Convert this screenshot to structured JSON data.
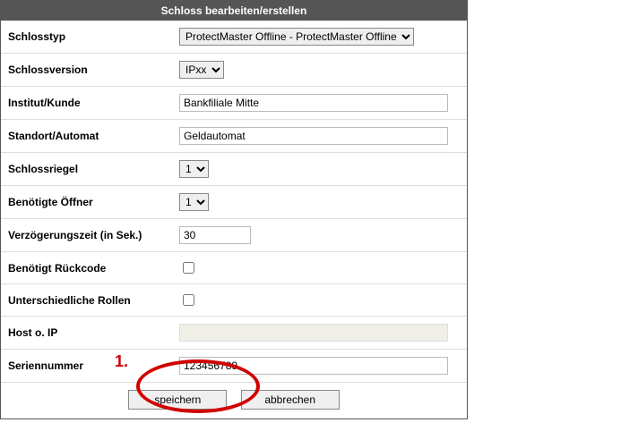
{
  "dialog": {
    "title": "Schloss bearbeiten/erstellen"
  },
  "labels": {
    "schlosstyp": "Schlosstyp",
    "schlossversion": "Schlossversion",
    "institut": "Institut/Kunde",
    "standort": "Standort/Automat",
    "schlossriegel": "Schlossriegel",
    "oeffner": "Benötigte Öffner",
    "verzoegerung": "Verzögerungszeit (in Sek.)",
    "rueckcode": "Benötigt Rückcode",
    "rollen": "Unterschiedliche Rollen",
    "host": "Host o. IP",
    "seriennummer": "Seriennummer"
  },
  "values": {
    "schlosstyp": "ProtectMaster Offline - ProtectMaster Offline",
    "schlossversion": "IPxx",
    "institut": "Bankfiliale Mitte",
    "standort": "Geldautomat",
    "schlossriegel": "1",
    "oeffner": "1",
    "verzoegerung": "30",
    "rueckcode_checked": false,
    "rollen_checked": false,
    "host": "",
    "seriennummer": "123456789"
  },
  "buttons": {
    "save": "speichern",
    "cancel": "abbrechen"
  },
  "annotation": {
    "marker1": "1."
  }
}
